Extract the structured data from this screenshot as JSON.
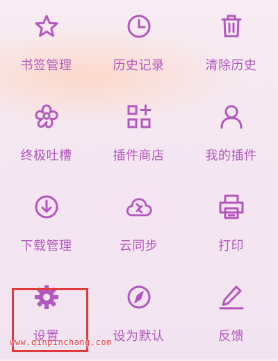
{
  "colors": {
    "accent": "#b257bd",
    "highlight": "#e03a3c",
    "watermark": "#e03a3c"
  },
  "menu": [
    {
      "id": "bookmarks",
      "label": "书签管理",
      "icon": "star-icon"
    },
    {
      "id": "history",
      "label": "历史记录",
      "icon": "clock-icon"
    },
    {
      "id": "clear-history",
      "label": "清除历史",
      "icon": "trash-icon"
    },
    {
      "id": "feedback-board",
      "label": "终极吐槽",
      "icon": "flower-icon"
    },
    {
      "id": "plugin-store",
      "label": "插件商店",
      "icon": "grid-plus-icon"
    },
    {
      "id": "my-plugins",
      "label": "我的插件",
      "icon": "user-icon"
    },
    {
      "id": "downloads",
      "label": "下载管理",
      "icon": "download-icon"
    },
    {
      "id": "cloud-sync",
      "label": "云同步",
      "icon": "cloud-sync-icon"
    },
    {
      "id": "print",
      "label": "打印",
      "icon": "printer-icon"
    },
    {
      "id": "settings",
      "label": "设置",
      "icon": "gear-icon"
    },
    {
      "id": "set-default",
      "label": "设为默认",
      "icon": "compass-icon"
    },
    {
      "id": "feedback",
      "label": "反馈",
      "icon": "pen-icon"
    }
  ],
  "watermark": "www.qinpinchang.com"
}
